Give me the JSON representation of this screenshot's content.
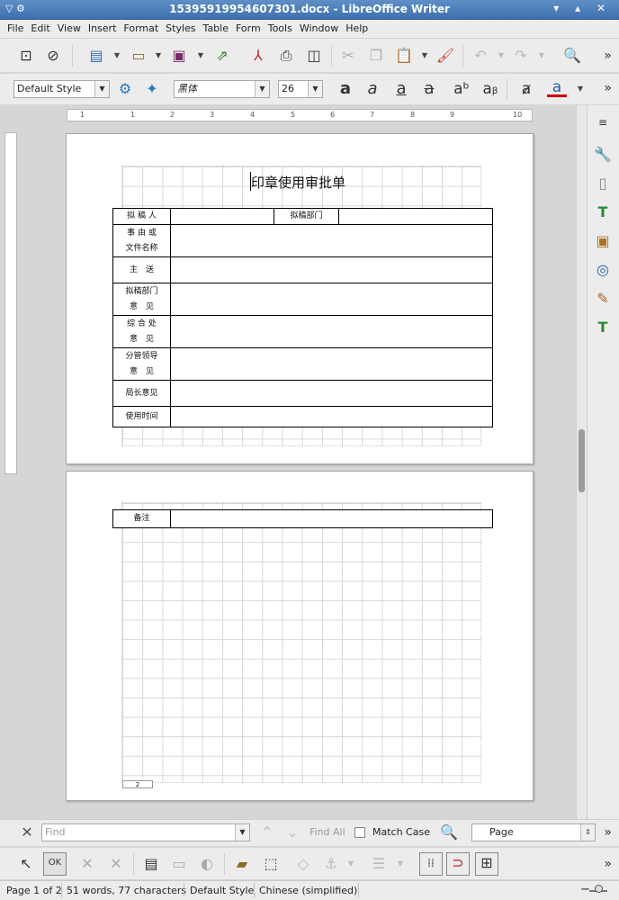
{
  "window": {
    "title": "15395919954607301.docx - LibreOffice Writer",
    "controls": "▾ ▴ ✕"
  },
  "menu": [
    "File",
    "Edit",
    "View",
    "Insert",
    "Format",
    "Styles",
    "Table",
    "Form",
    "Tools",
    "Window",
    "Help"
  ],
  "toolbar_icons": [
    "toggle-form-design-icon",
    "design-mode-icon",
    "new-document-icon",
    "open-icon",
    "save-icon",
    "export-icon",
    "export-pdf-icon",
    "print-icon",
    "print-preview-icon",
    "cut-icon",
    "copy-icon",
    "paste-icon",
    "clone-formatting-icon",
    "undo-icon",
    "redo-icon",
    "find-replace-icon"
  ],
  "format": {
    "paragraph_style": "Default Style",
    "font_name": "黑体",
    "font_size": "26",
    "underline_color": "#cc0000"
  },
  "ruler": {
    "ticks": [
      "1",
      "1",
      "2",
      "3",
      "4",
      "5",
      "6",
      "7",
      "8",
      "9",
      "10"
    ]
  },
  "document": {
    "title": "印章使用审批单",
    "form": [
      {
        "cells": [
          "拟 稿 人",
          "",
          "拟稿部门",
          ""
        ]
      },
      {
        "cells": [
          "事 由 或",
          "文件名称"
        ]
      },
      {
        "cells": [
          "主　送"
        ]
      },
      {
        "cells": [
          "拟稿部门",
          "意　见"
        ]
      },
      {
        "cells": [
          "综 合 处",
          "意　见"
        ]
      },
      {
        "cells": [
          "分管领导",
          "意　见"
        ]
      },
      {
        "cells": [
          "局长意见"
        ]
      },
      {
        "cells": [
          "使用时间"
        ]
      }
    ],
    "page2_label": "备注",
    "page2_footer": "2"
  },
  "findbar": {
    "placeholder": "Find",
    "find_all": "Find All",
    "match_case": "Match Case",
    "search_in": "Page"
  },
  "statusbar": {
    "page": "Page 1 of 2",
    "words": "51 words, 77 characters",
    "style": "Default Style",
    "language": "Chinese (simplified)"
  }
}
